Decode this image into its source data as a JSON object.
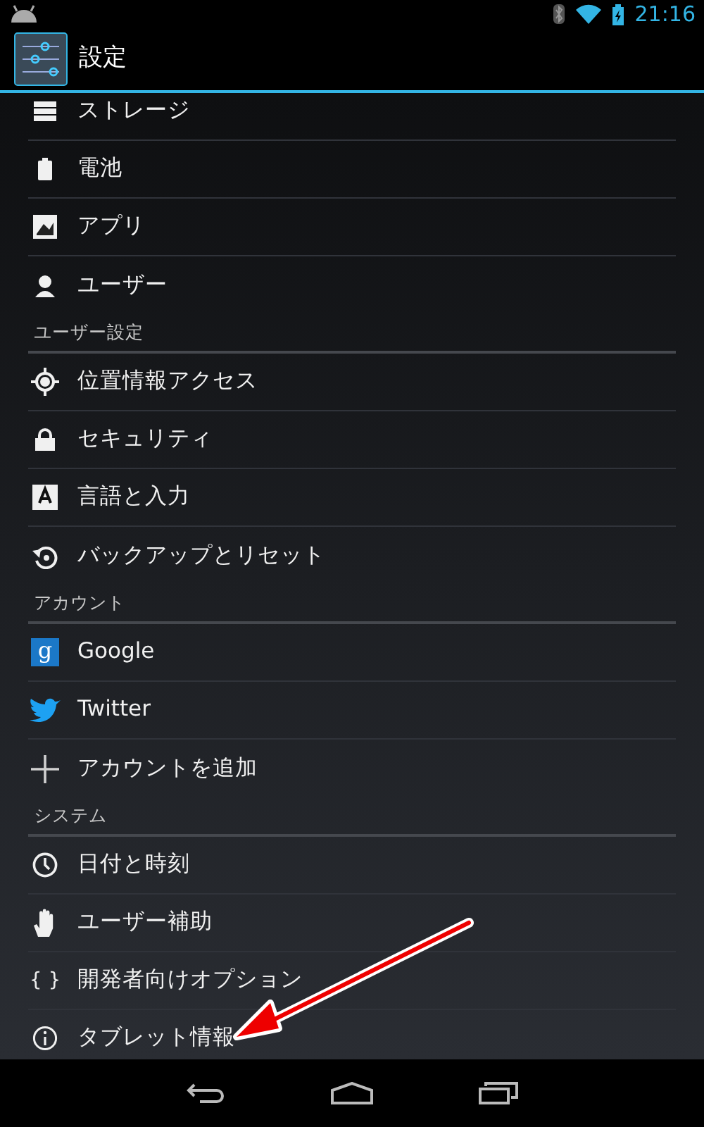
{
  "status_bar": {
    "time": "21:16"
  },
  "action_bar": {
    "title": "設定"
  },
  "sections": [
    {
      "items": [
        {
          "label": "ストレージ"
        },
        {
          "label": "電池"
        },
        {
          "label": "アプリ"
        },
        {
          "label": "ユーザー"
        }
      ]
    },
    {
      "header": "ユーザー設定",
      "items": [
        {
          "label": "位置情報アクセス"
        },
        {
          "label": "セキュリティ"
        },
        {
          "label": "言語と入力"
        },
        {
          "label": "バックアップとリセット"
        }
      ]
    },
    {
      "header": "アカウント",
      "items": [
        {
          "label": "Google",
          "icon_text": "g"
        },
        {
          "label": "Twitter"
        },
        {
          "label": "アカウントを追加"
        }
      ]
    },
    {
      "header": "システム",
      "items": [
        {
          "label": "日付と時刻"
        },
        {
          "label": "ユーザー補助"
        },
        {
          "label": "開発者向けオプション",
          "icon_text": "{ }"
        },
        {
          "label": "タブレット情報"
        }
      ]
    }
  ]
}
